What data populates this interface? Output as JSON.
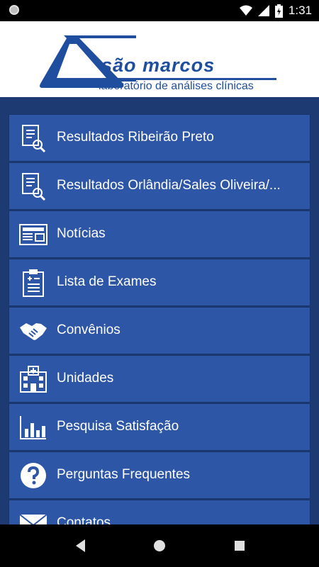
{
  "status_bar": {
    "time": "1:31"
  },
  "header": {
    "brand_name": "são marcos",
    "brand_subtitle": "laboratório de análises clínicas"
  },
  "menu": {
    "items": [
      {
        "label": "Resultados Ribeirão Preto",
        "icon": "document-search-icon"
      },
      {
        "label": "Resultados Orlândia/Sales Oliveira/...",
        "icon": "document-search-icon"
      },
      {
        "label": "Notícias",
        "icon": "newspaper-icon"
      },
      {
        "label": "Lista de Exames",
        "icon": "clipboard-icon"
      },
      {
        "label": "Convênios",
        "icon": "handshake-icon"
      },
      {
        "label": "Unidades",
        "icon": "hospital-building-icon"
      },
      {
        "label": "Pesquisa Satisfação",
        "icon": "bar-chart-icon"
      },
      {
        "label": "Perguntas Frequentes",
        "icon": "question-icon"
      },
      {
        "label": "Contatos",
        "icon": "envelope-icon"
      }
    ]
  },
  "colors": {
    "brand_blue": "#1f4e9f",
    "menu_item_bg": "#2e56a6",
    "background": "#1e3a73"
  }
}
